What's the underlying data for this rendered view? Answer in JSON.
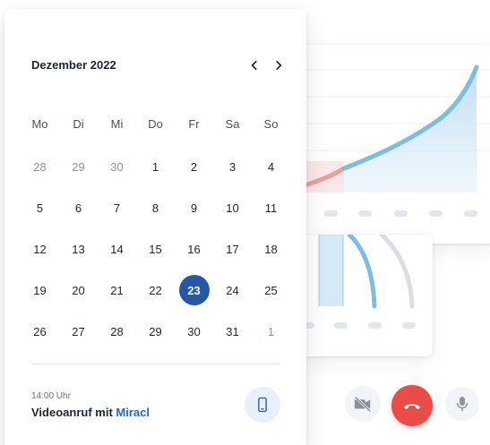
{
  "calendar": {
    "month_title": "Dezember 2022",
    "prev_icon": "chevron-left-icon",
    "next_icon": "chevron-right-icon",
    "weekdays": [
      "Mo",
      "Di",
      "Mi",
      "Do",
      "Fr",
      "Sa",
      "So"
    ],
    "weeks": [
      [
        "28",
        "29",
        "30",
        "1",
        "2",
        "3",
        "4"
      ],
      [
        "5",
        "6",
        "7",
        "8",
        "9",
        "10",
        "11"
      ],
      [
        "12",
        "13",
        "14",
        "15",
        "16",
        "17",
        "18"
      ],
      [
        "19",
        "20",
        "21",
        "22",
        "23",
        "24",
        "25"
      ],
      [
        "26",
        "27",
        "28",
        "29",
        "30",
        "31",
        "1"
      ]
    ],
    "selected_day": "23",
    "selected_color": "#2557a7"
  },
  "event": {
    "time": "14:00 Uhr",
    "title_prefix": "Videoanruf mit",
    "contact": "Miracl",
    "contact_color": "#2563c9",
    "action_icon": "smartphone-icon"
  },
  "call_controls": {
    "video_icon": "video-off-icon",
    "hangup_icon": "phone-hangup-icon",
    "hangup_color": "#ea4d48",
    "mic_icon": "microphone-icon"
  }
}
